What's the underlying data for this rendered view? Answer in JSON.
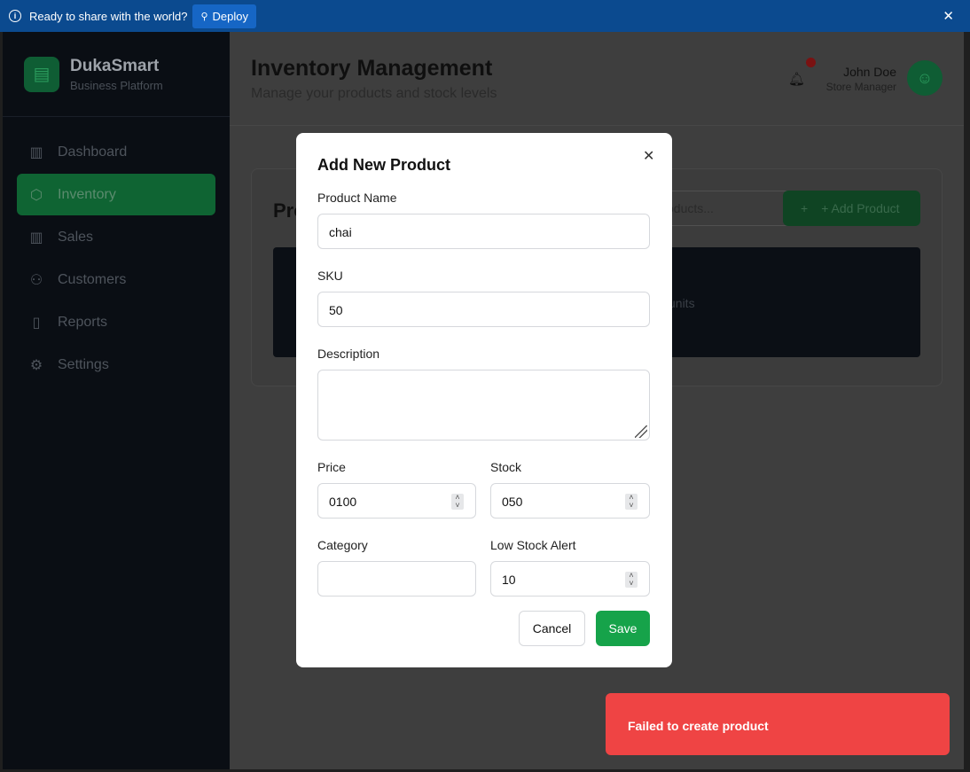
{
  "banner": {
    "message": "Ready to share with the world?",
    "deploy_label": "Deploy",
    "close_glyph": "✕"
  },
  "brand": {
    "name": "DukaSmart",
    "subtitle": "Business Platform",
    "logo_icon": "store-icon"
  },
  "sidebar": {
    "items": [
      {
        "label": "Dashboard",
        "icon": "bar-chart-icon",
        "active": false
      },
      {
        "label": "Inventory",
        "icon": "box-icon",
        "active": true
      },
      {
        "label": "Sales",
        "icon": "bar-chart-icon",
        "active": false
      },
      {
        "label": "Customers",
        "icon": "users-icon",
        "active": false
      },
      {
        "label": "Reports",
        "icon": "file-icon",
        "active": false
      },
      {
        "label": "Settings",
        "icon": "gear-icon",
        "active": false
      }
    ]
  },
  "header": {
    "title": "Inventory Management",
    "subtitle": "Manage your products and stock levels",
    "user_name": "John Doe",
    "user_role": "Store Manager"
  },
  "products_card": {
    "title_visible": "Pro",
    "search_placeholder_visible": "oducts...",
    "add_button": "+ Add Product",
    "row_visible_text": "units"
  },
  "modal": {
    "title": "Add New Product",
    "product_name_label": "Product Name",
    "product_name_value": "chai",
    "sku_label": "SKU",
    "sku_value": "50",
    "description_label": "Description",
    "description_value": "",
    "price_label": "Price",
    "price_value": "0100",
    "stock_label": "Stock",
    "stock_value": "050",
    "category_label": "Category",
    "category_value": "",
    "low_stock_label": "Low Stock Alert",
    "low_stock_value": "10",
    "cancel_label": "Cancel",
    "save_label": "Save"
  },
  "toast": {
    "message": "Failed to create product",
    "color": "#ef4444"
  },
  "colors": {
    "accent": "#16a34a",
    "banner": "#0b4a8f"
  }
}
